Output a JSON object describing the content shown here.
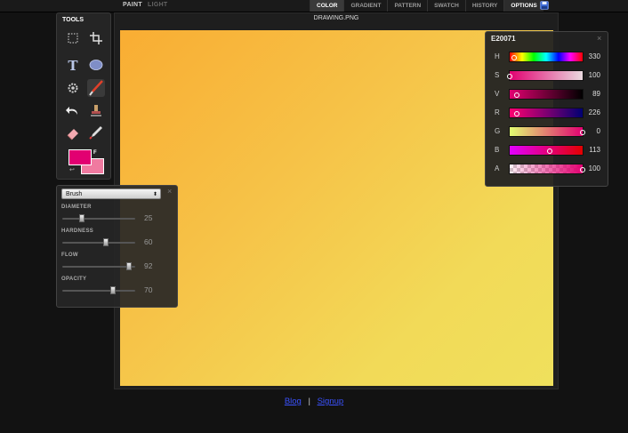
{
  "topbar": {
    "modes": [
      {
        "label": "PAINT",
        "active": true
      },
      {
        "label": "LIGHT",
        "active": false
      }
    ],
    "tabs": [
      {
        "label": "COLOR",
        "state": "active"
      },
      {
        "label": "GRADIENT",
        "state": ""
      },
      {
        "label": "PATTERN",
        "state": ""
      },
      {
        "label": "SWATCH",
        "state": ""
      },
      {
        "label": "HISTORY",
        "state": ""
      },
      {
        "label": "OPTIONS",
        "state": "selected"
      }
    ],
    "save_icon": "floppy-disk-icon"
  },
  "tools": {
    "title": "TOOLS",
    "items": [
      {
        "name": "marquee-select-icon"
      },
      {
        "name": "crop-icon"
      },
      {
        "name": "text-icon"
      },
      {
        "name": "ellipse-shape-icon"
      },
      {
        "name": "settings-gear-icon"
      },
      {
        "name": "brush-icon"
      },
      {
        "name": "undo-icon"
      },
      {
        "name": "stamp-icon"
      },
      {
        "name": "eraser-icon"
      },
      {
        "name": "eyedropper-icon"
      }
    ],
    "foreground_color": "#e20071",
    "background_color": "#f07aa0",
    "fg_label": "F"
  },
  "brush_panel": {
    "selected_brush": "Brush",
    "close": "×",
    "sliders": [
      {
        "label": "DIAMETER",
        "value": "25",
        "fraction": 0.27
      },
      {
        "label": "HARDNESS",
        "value": "60",
        "fraction": 0.6
      },
      {
        "label": "FLOW",
        "value": "92",
        "fraction": 0.92
      },
      {
        "label": "OPACITY",
        "value": "70",
        "fraction": 0.7
      }
    ]
  },
  "canvas": {
    "title": "DRAWING.PNG"
  },
  "color_panel": {
    "hex": "E20071",
    "close": "×",
    "channels": [
      {
        "label": "H",
        "value": "330",
        "fraction": 0.06,
        "gradient": "linear-gradient(90deg,#ff0000,#ffff00 17%,#00ff00 33%,#00ffff 50%,#0000ff 67%,#ff00ff 83%,#ff0000)"
      },
      {
        "label": "S",
        "value": "100",
        "fraction": 0.0,
        "gradient": "linear-gradient(90deg,#e20071,#eadadf)"
      },
      {
        "label": "V",
        "value": "89",
        "fraction": 0.1,
        "gradient": "linear-gradient(90deg,#e20071,#000000)"
      },
      {
        "label": "R",
        "value": "226",
        "fraction": 0.1,
        "gradient": "linear-gradient(90deg,#ff0071,#000071)"
      },
      {
        "label": "G",
        "value": "0",
        "fraction": 1.0,
        "gradient": "linear-gradient(90deg,#e2ff71,#e20071)"
      },
      {
        "label": "B",
        "value": "113",
        "fraction": 0.55,
        "gradient": "linear-gradient(90deg,#e200ff,#e20000)"
      },
      {
        "label": "A",
        "value": "100",
        "fraction": 1.0,
        "gradient": "linear-gradient(90deg,rgba(226,0,113,0.05),#e20071)"
      }
    ]
  },
  "footer": {
    "link1": "Blog",
    "separator": "|",
    "link2": "Signup"
  }
}
